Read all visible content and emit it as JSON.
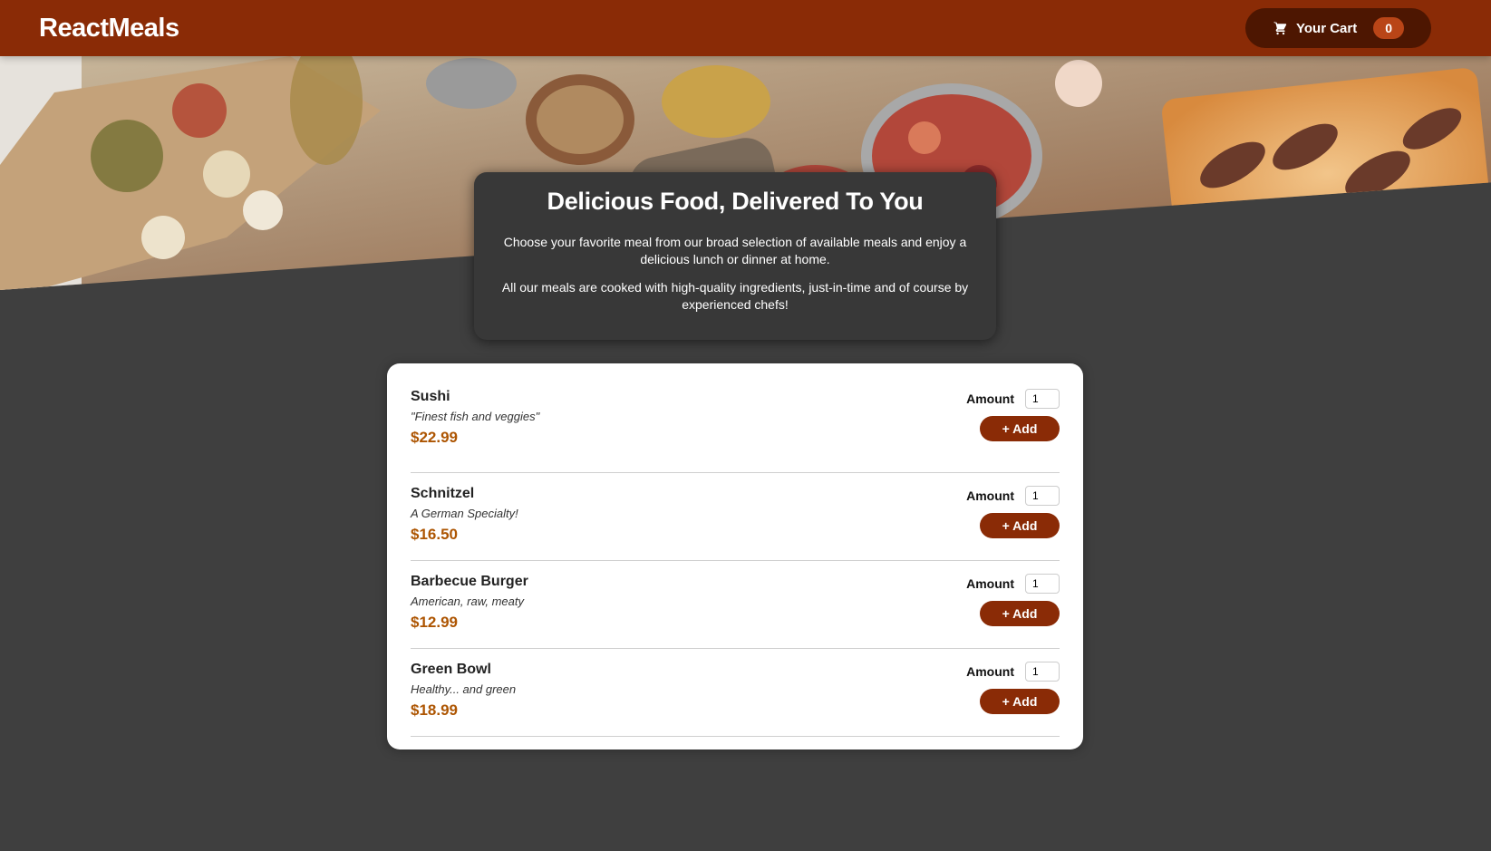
{
  "header": {
    "brand": "ReactMeals",
    "cart": {
      "label": "Your Cart",
      "icon": "cart-icon",
      "count": "0"
    }
  },
  "colors": {
    "header_bg": "#8a2b06",
    "cart_button_bg": "#4d1601",
    "cart_badge_bg": "#b94517",
    "page_bg": "#3f3f3f",
    "summary_bg": "#383838",
    "price": "#ad5502",
    "add_button_bg": "#8a2b06"
  },
  "summary": {
    "title": "Delicious Food, Delivered To You",
    "paragraph1": "Choose your favorite meal from our broad selection of available meals and enjoy a delicious lunch or dinner at home.",
    "paragraph2": "All our meals are cooked with high-quality ingredients, just-in-time and of course by experienced chefs!"
  },
  "meals": [
    {
      "name": "Sushi",
      "description": "\"Finest fish and veggies\"",
      "price": "$22.99",
      "amount_label": "Amount",
      "amount_value": "1",
      "add_label": "+ Add"
    },
    {
      "name": "Schnitzel",
      "description": "A German Specialty!",
      "price": "$16.50",
      "amount_label": "Amount",
      "amount_value": "1",
      "add_label": "+ Add"
    },
    {
      "name": "Barbecue Burger",
      "description": "American, raw, meaty",
      "price": "$12.99",
      "amount_label": "Amount",
      "amount_value": "1",
      "add_label": "+ Add"
    },
    {
      "name": "Green Bowl",
      "description": "Healthy... and green",
      "price": "$18.99",
      "amount_label": "Amount",
      "amount_value": "1",
      "add_label": "+ Add"
    }
  ]
}
